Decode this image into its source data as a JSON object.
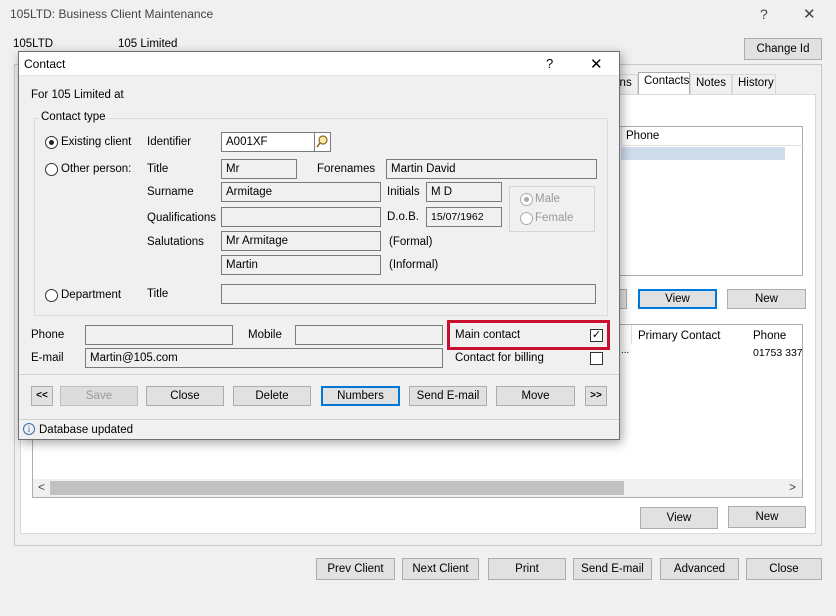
{
  "window": {
    "title": "105LTD: Business Client Maintenance",
    "help": "?",
    "close": "✕",
    "client_id": "105LTD",
    "client_name": "105 Limited",
    "change_id_label": "Change Id",
    "tabs": [
      "ins",
      "Contacts",
      "Notes",
      "History"
    ],
    "upper_list_header": "Phone",
    "view_label": "View",
    "new_label": "New",
    "lower_list_headers": [
      "Primary Contact",
      "Phone"
    ],
    "lower_list_row": {
      "dots": "...",
      "phone": "01753 337"
    },
    "scroll_left": "<",
    "scroll_right": ">",
    "bottom_buttons": [
      "Prev Client",
      "Next Client",
      "Print",
      "Send E-mail",
      "Advanced",
      "Close"
    ]
  },
  "dialog": {
    "title": "Contact",
    "help": "?",
    "close": "✕",
    "for_text": "For 105 Limited at",
    "contact_type_label": "Contact type",
    "existing_client_label": "Existing client",
    "other_person_label": "Other person:",
    "department_label": "Department",
    "identifier_label": "Identifier",
    "identifier_value": "A001XF",
    "title_label": "Title",
    "title_value": "Mr",
    "forenames_label": "Forenames",
    "forenames_value": "Martin David",
    "surname_label": "Surname",
    "surname_value": "Armitage",
    "initials_label": "Initials",
    "initials_value": "M D",
    "qualifications_label": "Qualifications",
    "qualifications_value": "",
    "dob_label": "D.o.B.",
    "dob_value": "15/07/1962",
    "male_label": "Male",
    "female_label": "Female",
    "salutations_label": "Salutations",
    "salutation_formal_value": "Mr Armitage",
    "formal_label": "(Formal)",
    "salutation_informal_value": "Martin",
    "informal_label": "(Informal)",
    "dept_title_label": "Title",
    "dept_title_value": "",
    "phone_label": "Phone",
    "phone_value": "",
    "mobile_label": "Mobile",
    "mobile_value": "",
    "email_label": "E-mail",
    "email_value": "Martin@105.com",
    "main_contact_label": "Main contact",
    "main_contact_checked": true,
    "billing_label": "Contact for billing",
    "billing_checked": false,
    "highlight_color": "#c8102e",
    "first_label": "<<",
    "save_label": "Save",
    "close_label": "Close",
    "delete_label": "Delete",
    "numbers_label": "Numbers",
    "send_email_label": "Send E-mail",
    "move_label": "Move",
    "last_label": ">>",
    "status_text": "Database updated",
    "info_icon": "i"
  }
}
